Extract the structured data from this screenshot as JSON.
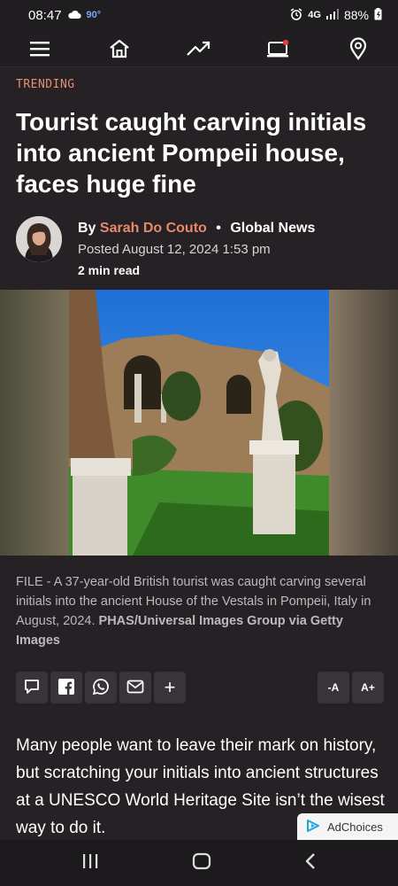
{
  "status": {
    "time": "08:47",
    "temp": "90°",
    "network": "4G",
    "battery": "88%"
  },
  "nav": {
    "items": [
      "menu-icon",
      "home-icon",
      "trending-icon",
      "watch-icon",
      "location-icon"
    ]
  },
  "article": {
    "kicker": "TRENDING",
    "headline": "Tourist caught carving initials into ancient Pompeii house, faces huge fine",
    "by_prefix": "By",
    "author": "Sarah Do Couto",
    "separator": "•",
    "outlet": "Global News",
    "posted": "Posted August 12, 2024 1:53 pm",
    "read_time": "2 min read",
    "caption_text": "FILE - A 37-year-old British tourist was caught carving several initials into the ancient House of the Vestals in Pompeii, Italy in August, 2024.",
    "caption_credit": "PHAS/Universal Images Group via Getty Images",
    "body": "Many people want to leave their mark on history, but scratching your initials into ancient structures at a UNESCO World Heritage Site isn’t the wisest way to do it."
  },
  "share": {
    "comment": "comment-icon",
    "facebook": "facebook-icon",
    "whatsapp": "whatsapp-icon",
    "email": "email-icon",
    "more": "+",
    "font_smaller": "-A",
    "font_larger": "A+"
  },
  "ad": {
    "label": "AdChoices"
  },
  "colors": {
    "accent": "#e8896a",
    "background": "#252124",
    "kicker": "#e59172"
  }
}
